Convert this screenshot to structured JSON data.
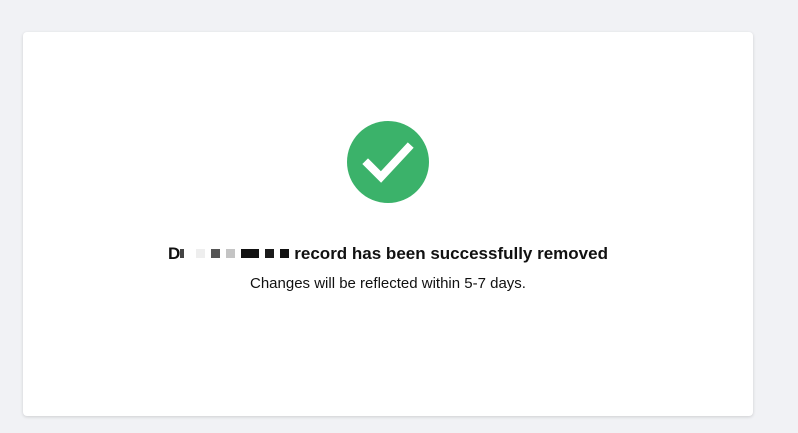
{
  "card": {
    "icon": "checkmark-circle-icon",
    "title_prefix": "D",
    "title_suffix": "record has been successfully removed",
    "subtitle": "Changes will be reflected within 5-7 days."
  },
  "colors": {
    "success_green": "#3bb26a",
    "page_background": "#f1f2f5",
    "card_background": "#ffffff"
  }
}
